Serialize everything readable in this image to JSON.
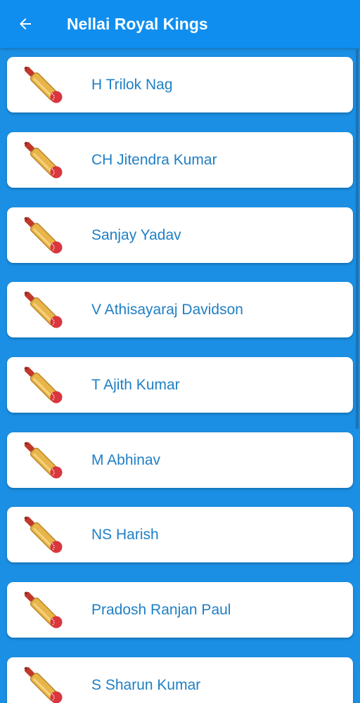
{
  "appbar": {
    "title": "Nellai Royal Kings",
    "back_icon": "arrow-left-icon"
  },
  "players": [
    {
      "name": "H Trilok Nag",
      "icon": "cricket-bat-ball-icon"
    },
    {
      "name": "CH Jitendra Kumar",
      "icon": "cricket-bat-ball-icon"
    },
    {
      "name": "Sanjay Yadav",
      "icon": "cricket-bat-ball-icon"
    },
    {
      "name": "V Athisayaraj Davidson",
      "icon": "cricket-bat-ball-icon"
    },
    {
      "name": "T Ajith Kumar",
      "icon": "cricket-bat-ball-icon"
    },
    {
      "name": "M Abhinav",
      "icon": "cricket-bat-ball-icon"
    },
    {
      "name": "NS Harish",
      "icon": "cricket-bat-ball-icon"
    },
    {
      "name": "Pradosh Ranjan Paul",
      "icon": "cricket-bat-ball-icon"
    },
    {
      "name": "S Sharun Kumar",
      "icon": "cricket-bat-ball-icon"
    }
  ],
  "colors": {
    "appbar": "#0f8ef0",
    "background": "#1a8fe3",
    "name_text": "#1f7fc4"
  }
}
